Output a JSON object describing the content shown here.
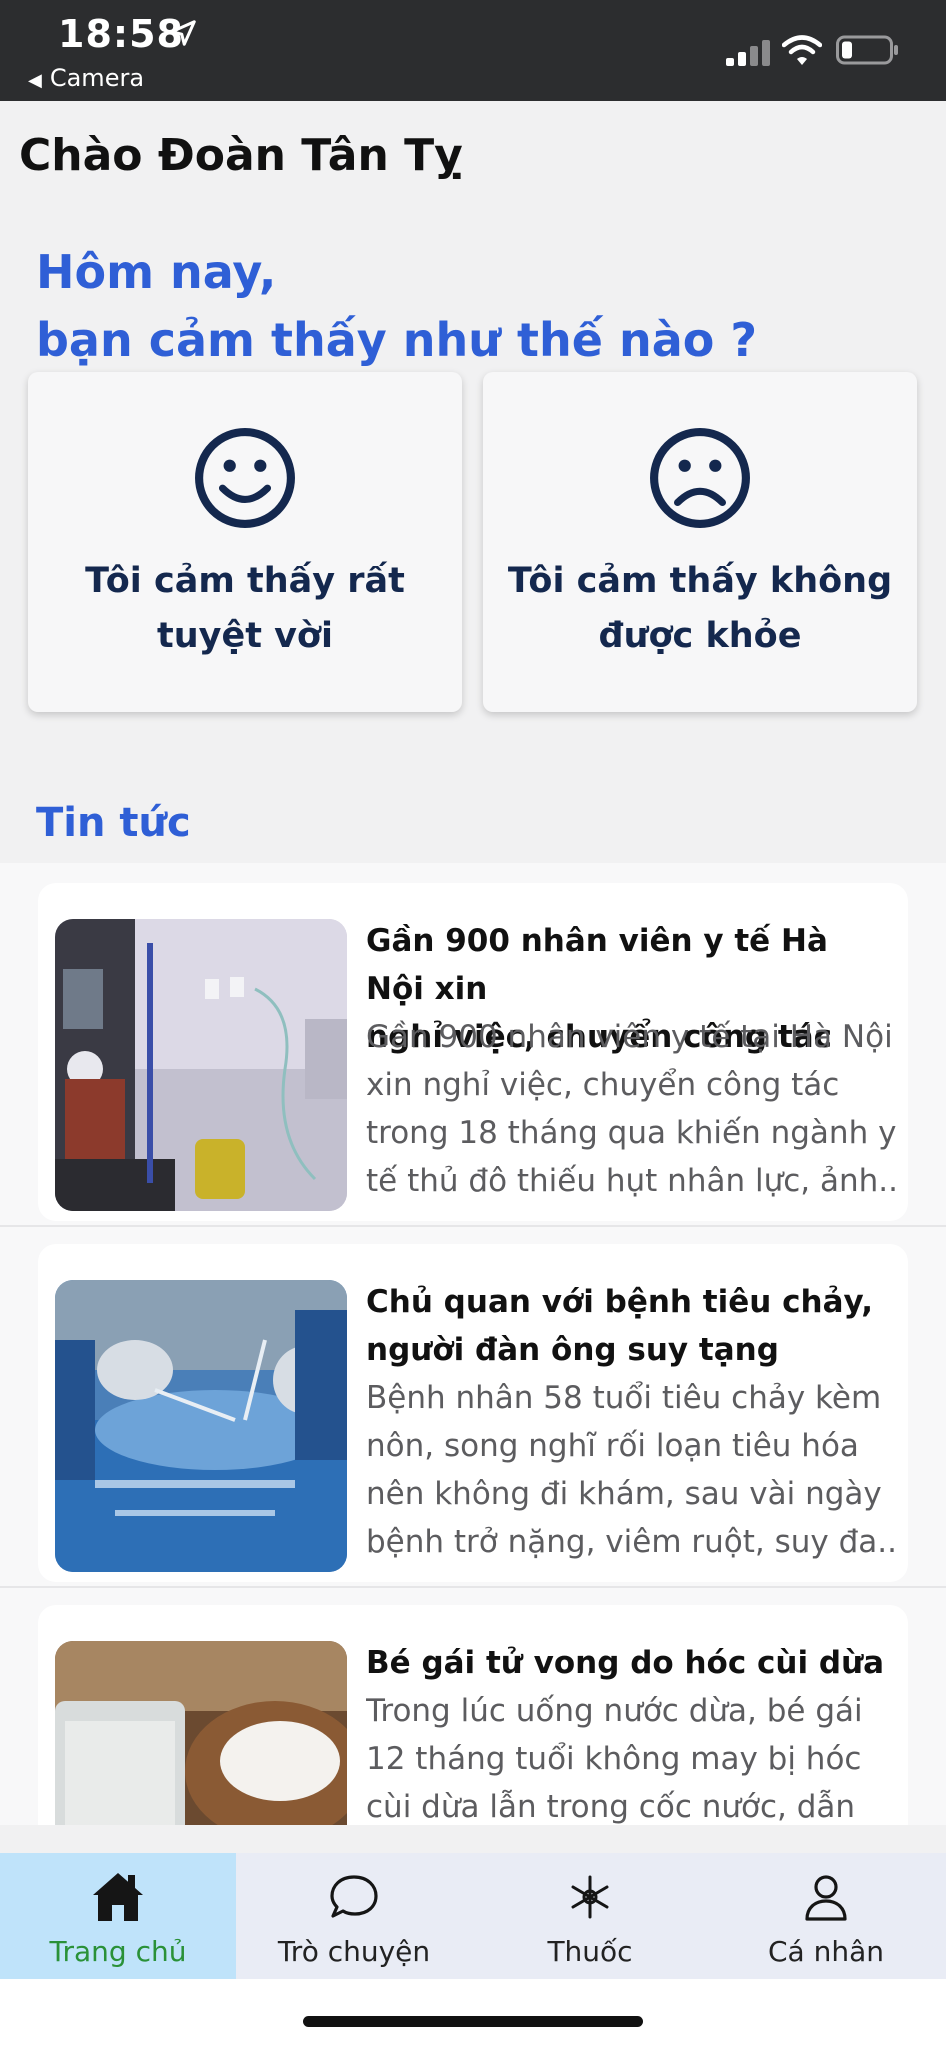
{
  "status_bar": {
    "time": "18:58",
    "back_app": "Camera"
  },
  "header": {
    "greeting": "Chào Đoàn Tân Tỵ"
  },
  "mood": {
    "question_line1": "Hôm nay,",
    "question_line2": "bạn cảm thấy như thế nào ?",
    "good": {
      "line1": "Tôi cảm thấy rất",
      "line2": "tuyệt vời",
      "icon": "smile-face-icon"
    },
    "bad": {
      "line1": "Tôi cảm thấy không",
      "line2": "được khỏe",
      "icon": "sad-face-icon"
    }
  },
  "news": {
    "section_title": "Tin tức",
    "items": [
      {
        "title1": "Gần 900 nhân viên y tế Hà Nội xin",
        "title2": "nghỉ việc, chuyển công tác",
        "d1": "Gần 900 nhân viên y tế tại Hà Nội",
        "d2": "xin nghỉ việc, chuyển công tác",
        "d3": "trong 18 tháng qua khiến ngành y",
        "d4": "tế thủ đô thiếu hụt nhân lực, ảnh...",
        "image": "ambulance-interior-photo"
      },
      {
        "title1": "Chủ quan với bệnh tiêu chảy,",
        "title2": "người đàn ông suy tạng",
        "d1": "Bệnh nhân 58 tuổi tiêu chảy kèm",
        "d2": "nôn, song nghĩ rối loạn tiêu hóa",
        "d3": "nên không đi khám, sau vài ngày",
        "d4": "bệnh trở nặng, viêm ruột, suy đa...",
        "image": "surgery-photo"
      },
      {
        "title1": "Bé gái tử vong do hóc cùi dừa",
        "d1": "Trong lúc uống nước dừa, bé gái",
        "d2": "12 tháng tuổi không may bị hóc",
        "d3": "cùi dừa lẫn trong cốc nước, dẫn",
        "image": "coconut-water-photo"
      }
    ]
  },
  "tabs": [
    {
      "label": "Trang chủ",
      "icon": "home-icon",
      "active": true
    },
    {
      "label": "Trò chuyện",
      "icon": "chat-icon",
      "active": false
    },
    {
      "label": "Thuốc",
      "icon": "medicine-icon",
      "active": false
    },
    {
      "label": "Cá nhân",
      "icon": "person-icon",
      "active": false
    }
  ],
  "colors": {
    "accent": "#2f5fd6",
    "active_tab_bg": "#bfe3fa",
    "active_tab_text": "#2a9138",
    "dark_navy": "#14284e"
  }
}
